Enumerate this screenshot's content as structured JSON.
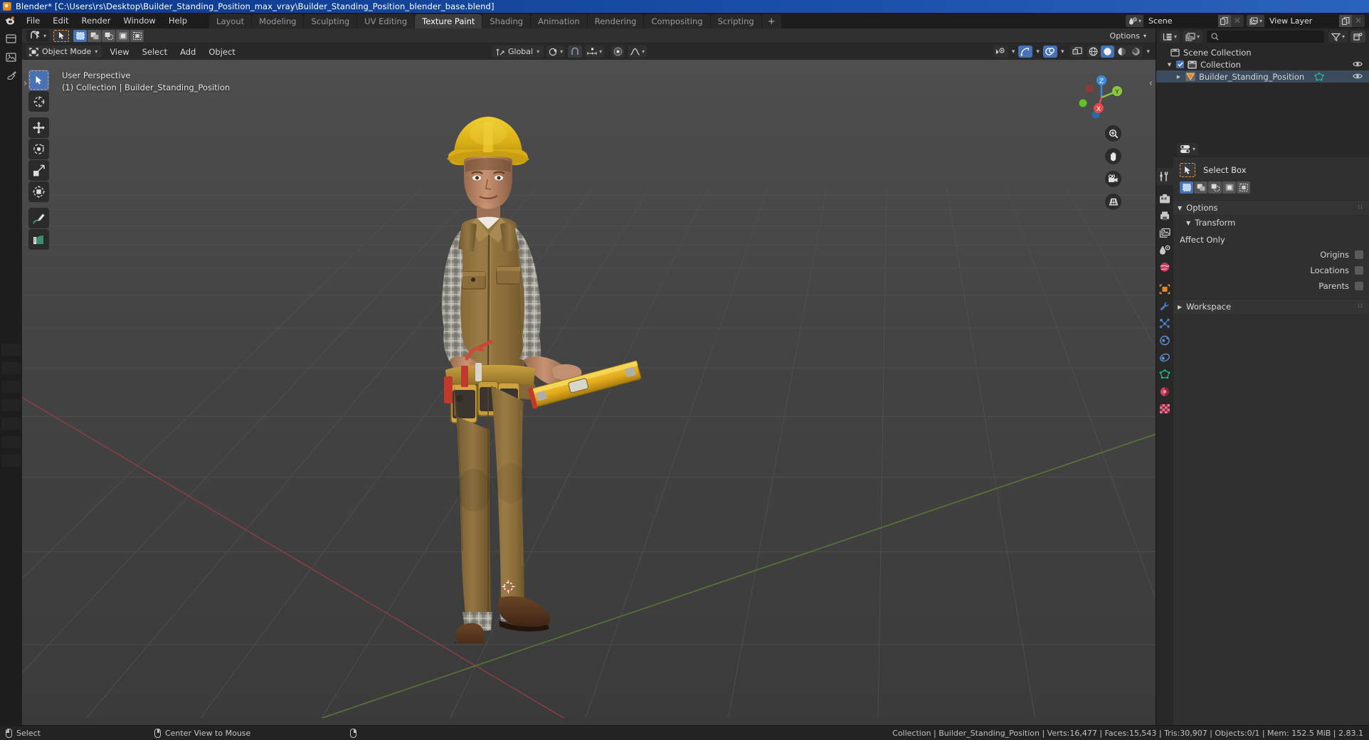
{
  "titlebar": {
    "text": "Blender* [C:\\Users\\rs\\Desktop\\Builder_Standing_Position_max_vray\\Builder_Standing_Position_blender_base.blend]",
    "icon": "blender-logo-icon"
  },
  "menus": [
    "File",
    "Edit",
    "Render",
    "Window",
    "Help"
  ],
  "workspace_tabs": [
    {
      "label": "Layout",
      "active": false
    },
    {
      "label": "Modeling",
      "active": false
    },
    {
      "label": "Sculpting",
      "active": false
    },
    {
      "label": "UV Editing",
      "active": false
    },
    {
      "label": "Texture Paint",
      "active": true
    },
    {
      "label": "Shading",
      "active": false
    },
    {
      "label": "Animation",
      "active": false
    },
    {
      "label": "Rendering",
      "active": false
    },
    {
      "label": "Compositing",
      "active": false
    },
    {
      "label": "Scripting",
      "active": false
    },
    {
      "label": "+",
      "active": false
    }
  ],
  "topbar_right": {
    "scene_name": "Scene",
    "view_layer_name": "View Layer",
    "scene_icon": "scene-data-icon",
    "view_layer_icon": "view-layer-icon",
    "new_icon": "new-copy-icon",
    "unlink_icon": "unlink-x-icon"
  },
  "tool_settings": {
    "active_tool_icon": "select-box-cursor-icon",
    "snap_icon": "snap-magnet-icon",
    "select_modes": [
      "set",
      "extend",
      "subtract",
      "invert",
      "intersect"
    ],
    "active_select_mode": 0,
    "options_label": "Options"
  },
  "viewport_header": {
    "mode": "Object Mode",
    "mode_icon": "object-mode-icon",
    "menus": [
      "View",
      "Select",
      "Add",
      "Object"
    ],
    "transform_orientation": "Global",
    "transform_icon": "transform-orientation-icon",
    "pivot_icon": "pivot-point-icon",
    "snap_magnet_icon": "magnet-icon",
    "snap_to_icon": "snap-increment-icon",
    "proportional_icon": "proportional-edit-icon",
    "falloff_icon": "falloff-curve-icon",
    "visibility_icon": "object-types-visibility-icon",
    "gizmo_icon": "gizmo-icon",
    "overlays_icon": "overlays-icon",
    "xray_icon": "xray-toggle-icon",
    "shading_modes": [
      "wireframe",
      "solid",
      "material-preview",
      "rendered"
    ],
    "active_shading": 1
  },
  "viewport": {
    "perspective_label": "User Perspective",
    "scene_label": "(1) Collection | Builder_Standing_Position",
    "gizmo_axes": [
      {
        "name": "Z",
        "color": "#3d8ce0",
        "label": "Z"
      },
      {
        "name": "Y",
        "color": "#8cc63e",
        "label": "Y"
      },
      {
        "name": "X",
        "color": "#e04a4a",
        "label": "X"
      }
    ],
    "nav_buttons": [
      "zoom-icon",
      "pan-hand-icon",
      "camera-view-icon",
      "toggle-perspective-icon"
    ],
    "tools": [
      {
        "name": "tweak-select-box",
        "active": true
      },
      {
        "name": "cursor-tool",
        "active": false
      },
      {
        "name": "move-tool",
        "active": false
      },
      {
        "name": "rotate-tool",
        "active": false
      },
      {
        "name": "scale-tool",
        "active": false
      },
      {
        "name": "transform-tool",
        "active": false
      },
      {
        "name": "annotate-tool",
        "active": false
      },
      {
        "name": "measure-tool",
        "active": false
      }
    ]
  },
  "outliner": {
    "display_mode_icon": "outliner-display-mode-icon",
    "filter_id_icon": "outliner-id-type-icon",
    "search_placeholder": "",
    "search_icon": "search-icon",
    "filter_icon": "filter-funnel-icon",
    "new_collection_icon": "new-collection-icon",
    "rows": [
      {
        "label": "Scene Collection",
        "icon": "collection-icon",
        "indent": 0,
        "selected": false,
        "has_eye": false,
        "has_check": false,
        "disclosure": ""
      },
      {
        "label": "Collection",
        "icon": "collection-icon",
        "indent": 1,
        "selected": false,
        "has_eye": true,
        "has_check": true,
        "disclosure": "down"
      },
      {
        "label": "Builder_Standing_Position",
        "icon": "mesh-object-icon",
        "indent": 2,
        "selected": true,
        "has_eye": true,
        "has_check": false,
        "disclosure": "right",
        "data_icon": "mesh-data-icon"
      }
    ]
  },
  "properties": {
    "tab_icons": [
      "tool-icon",
      "render-icon",
      "output-icon",
      "view-layer-icon",
      "scene-icon",
      "world-icon",
      "object-icon",
      "modifier-wrench-icon",
      "particles-icon",
      "physics-icon",
      "object-constraints-icon",
      "object-data-icon",
      "material-icon",
      "texture-icon"
    ],
    "active_tab": 0,
    "editor_type_icon": "properties-editor-icon",
    "tool_name": "Select Box",
    "tool_icon": "select-box-cursor-icon",
    "select_modes": [
      "set",
      "extend",
      "subtract",
      "invert",
      "intersect"
    ],
    "active_select_mode": 0,
    "panels": [
      {
        "title": "Options",
        "open": true,
        "level": 0
      },
      {
        "title": "Transform",
        "open": true,
        "level": 1
      }
    ],
    "affect_only_label": "Affect Only",
    "checkboxes": [
      {
        "label": "Origins",
        "checked": false
      },
      {
        "label": "Locations",
        "checked": false
      },
      {
        "label": "Parents",
        "checked": false
      }
    ],
    "workspace_panel": {
      "title": "Workspace",
      "open": false
    }
  },
  "statusbar": {
    "keymap": [
      {
        "icon": "mouse-left-icon",
        "label": "Select"
      },
      {
        "icon": "mouse-middle-icon",
        "label": "Center View to Mouse"
      },
      {
        "icon": "mouse-right-icon",
        "label": ""
      }
    ],
    "stats": "Collection | Builder_Standing_Position | Verts:16,477 | Faces:15,543 | Tris:30,907 | Objects:0/1 | Mem: 152.5 MiB | 2.83.1"
  },
  "colors": {
    "accent_blue": "#4772b3",
    "accent_orange": "#e8973f",
    "axis_x": "#e04a4a",
    "axis_y": "#8cc63e",
    "axis_z": "#3d8ce0",
    "titlebar": "#1a4fa8",
    "panel_bg": "#303030",
    "header_bg": "#282828"
  }
}
